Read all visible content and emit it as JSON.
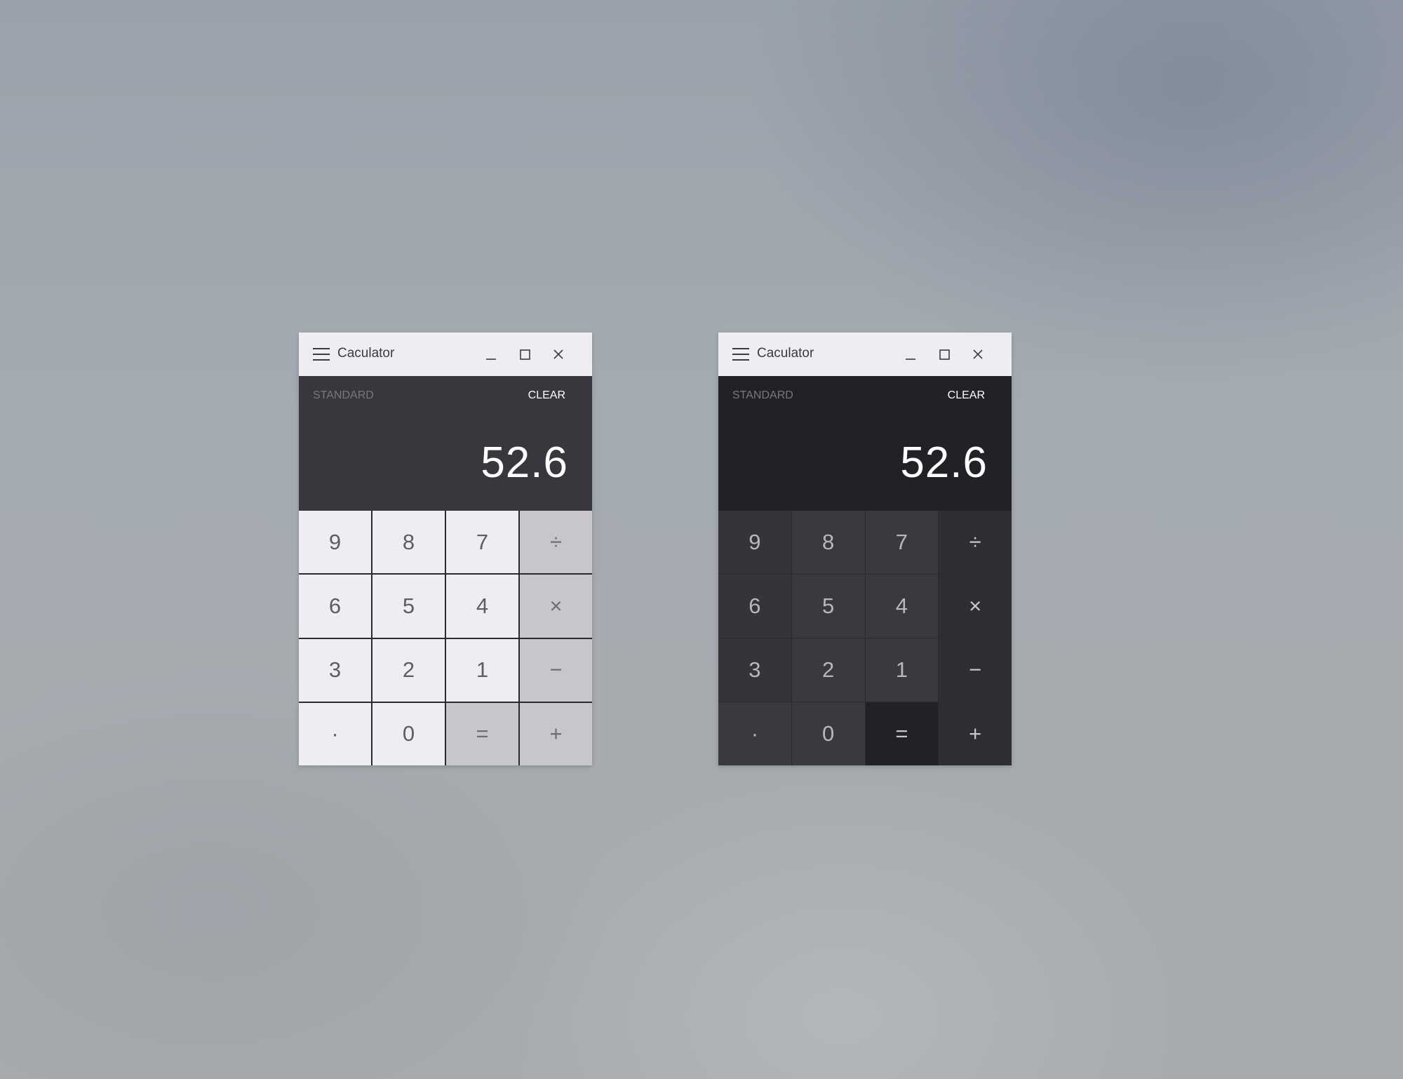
{
  "windows": [
    {
      "theme": "light",
      "title": "Caculator",
      "mode": "STANDARD",
      "clear_label": "CLEAR",
      "display_value": "52.6",
      "keys": [
        {
          "label": "9",
          "kind": "num"
        },
        {
          "label": "8",
          "kind": "num"
        },
        {
          "label": "7",
          "kind": "num"
        },
        {
          "label": "÷",
          "kind": "op"
        },
        {
          "label": "6",
          "kind": "num"
        },
        {
          "label": "5",
          "kind": "num"
        },
        {
          "label": "4",
          "kind": "num"
        },
        {
          "label": "×",
          "kind": "op"
        },
        {
          "label": "3",
          "kind": "num"
        },
        {
          "label": "2",
          "kind": "num"
        },
        {
          "label": "1",
          "kind": "num"
        },
        {
          "label": "−",
          "kind": "op"
        },
        {
          "label": "·",
          "kind": "num"
        },
        {
          "label": "0",
          "kind": "num"
        },
        {
          "label": "=",
          "kind": "eq"
        },
        {
          "label": "+",
          "kind": "op"
        }
      ]
    },
    {
      "theme": "dark",
      "title": "Caculator",
      "mode": "STANDARD",
      "clear_label": "CLEAR",
      "display_value": "52.6",
      "keys": [
        {
          "label": "9",
          "kind": "num"
        },
        {
          "label": "8",
          "kind": "num"
        },
        {
          "label": "7",
          "kind": "num"
        },
        {
          "label": "÷",
          "kind": "op"
        },
        {
          "label": "6",
          "kind": "num"
        },
        {
          "label": "5",
          "kind": "num"
        },
        {
          "label": "4",
          "kind": "num"
        },
        {
          "label": "×",
          "kind": "op"
        },
        {
          "label": "3",
          "kind": "num"
        },
        {
          "label": "2",
          "kind": "num"
        },
        {
          "label": "1",
          "kind": "num"
        },
        {
          "label": "−",
          "kind": "op"
        },
        {
          "label": "·",
          "kind": "num"
        },
        {
          "label": "0",
          "kind": "num"
        },
        {
          "label": "=",
          "kind": "eq"
        },
        {
          "label": "+",
          "kind": "op"
        }
      ]
    }
  ],
  "icons": {
    "menu": "hamburger-menu-icon",
    "minimize": "minimize-icon",
    "maximize": "maximize-icon",
    "close": "close-icon"
  },
  "colors": {
    "light_titlebar": "#eeedf2",
    "light_display": "#37373d",
    "light_key": "#eeedf2",
    "light_op_key": "#c7c7cb",
    "dark_display": "#222226",
    "dark_key": "#39393f",
    "dark_op_key": "#2d2d32"
  }
}
